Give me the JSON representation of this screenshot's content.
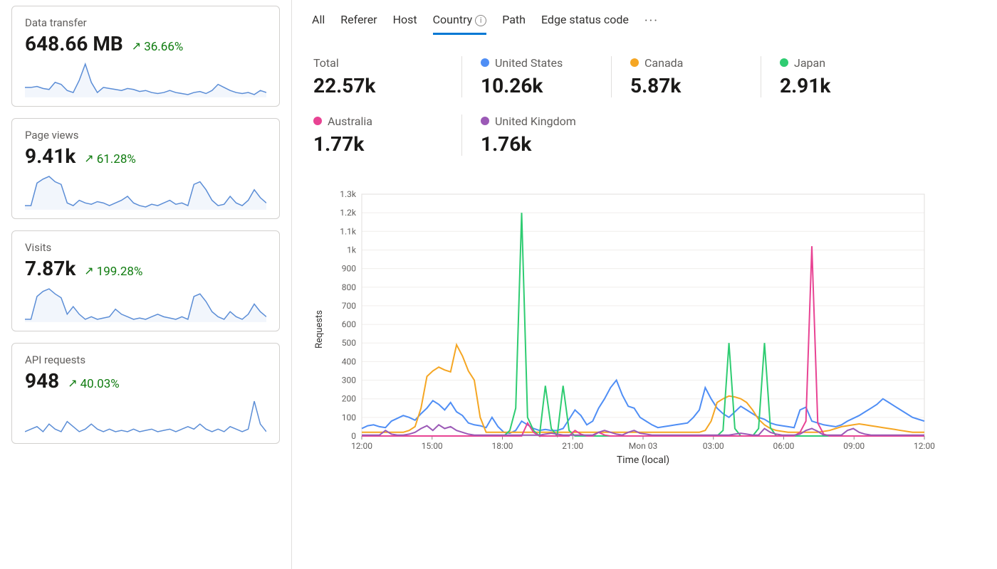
{
  "sidebar": {
    "cards": [
      {
        "label": "Data transfer",
        "value": "648.66 MB",
        "delta": "36.66%"
      },
      {
        "label": "Page views",
        "value": "9.41k",
        "delta": "61.28%"
      },
      {
        "label": "Visits",
        "value": "7.87k",
        "delta": "199.28%"
      },
      {
        "label": "API requests",
        "value": "948",
        "delta": "40.03%"
      }
    ]
  },
  "tabs": {
    "items": [
      "All",
      "Referer",
      "Host",
      "Country",
      "Path",
      "Edge status code"
    ],
    "active": "Country",
    "more_icon": "more-icon"
  },
  "stats": [
    {
      "label": "Total",
      "value": "22.57k",
      "color": null,
      "rowstart": true
    },
    {
      "label": "United States",
      "value": "10.26k",
      "color": "#4f8ef5"
    },
    {
      "label": "Canada",
      "value": "5.87k",
      "color": "#f5a623"
    },
    {
      "label": "Japan",
      "value": "2.91k",
      "color": "#2ecc71"
    },
    {
      "label": "Australia",
      "value": "1.77k",
      "color": "#e84393",
      "rowstart": true
    },
    {
      "label": "United Kingdom",
      "value": "1.76k",
      "color": "#9b59b6"
    }
  ],
  "chart_data": {
    "type": "line",
    "xlabel": "Time (local)",
    "ylabel": "Requests",
    "ylim": [
      0,
      1300
    ],
    "x_ticks": [
      "12:00",
      "15:00",
      "18:00",
      "21:00",
      "Mon 03",
      "03:00",
      "06:00",
      "09:00",
      "12:00"
    ],
    "y_ticks": [
      0,
      100,
      200,
      300,
      400,
      500,
      600,
      700,
      800,
      900,
      1000,
      1100,
      1200,
      1300
    ],
    "y_tick_labels": [
      "0",
      "100",
      "200",
      "300",
      "400",
      "500",
      "600",
      "700",
      "800",
      "900",
      "1k",
      "1.1k",
      "1.2k",
      "1.3k"
    ],
    "point_count": 96,
    "series": [
      {
        "name": "United States",
        "color": "#4f8ef5",
        "values": [
          40,
          55,
          60,
          50,
          45,
          80,
          95,
          110,
          100,
          85,
          120,
          150,
          190,
          170,
          140,
          180,
          130,
          110,
          70,
          60,
          55,
          45,
          100,
          50,
          20,
          15,
          30,
          80,
          60,
          40,
          30,
          35,
          30,
          30,
          40,
          90,
          140,
          110,
          60,
          80,
          150,
          200,
          260,
          300,
          220,
          160,
          150,
          100,
          80,
          60,
          45,
          50,
          55,
          60,
          65,
          70,
          100,
          140,
          260,
          200,
          150,
          120,
          100,
          130,
          160,
          140,
          120,
          100,
          90,
          70,
          60,
          55,
          50,
          45,
          140,
          155,
          80,
          70,
          60,
          55,
          50,
          60,
          80,
          95,
          110,
          130,
          150,
          170,
          200,
          180,
          160,
          140,
          120,
          100,
          90,
          80
        ]
      },
      {
        "name": "Canada",
        "color": "#f5a623",
        "values": [
          20,
          20,
          20,
          20,
          20,
          20,
          20,
          20,
          30,
          50,
          150,
          320,
          350,
          370,
          355,
          345,
          490,
          430,
          350,
          300,
          100,
          20,
          20,
          20,
          20,
          20,
          20,
          20,
          20,
          20,
          20,
          20,
          20,
          20,
          20,
          20,
          20,
          20,
          20,
          20,
          20,
          20,
          20,
          20,
          20,
          20,
          20,
          20,
          20,
          20,
          20,
          20,
          20,
          20,
          20,
          20,
          20,
          20,
          30,
          80,
          180,
          200,
          215,
          210,
          200,
          180,
          140,
          90,
          60,
          40,
          30,
          25,
          20,
          20,
          20,
          20,
          20,
          20,
          25,
          30,
          40,
          50,
          55,
          60,
          65,
          60,
          55,
          50,
          45,
          40,
          35,
          30,
          25,
          20,
          20,
          20
        ]
      },
      {
        "name": "Japan",
        "color": "#2ecc71",
        "values": [
          0,
          0,
          0,
          0,
          0,
          0,
          0,
          0,
          0,
          0,
          0,
          0,
          0,
          0,
          0,
          0,
          0,
          0,
          0,
          0,
          0,
          0,
          0,
          0,
          0,
          30,
          150,
          1200,
          100,
          30,
          0,
          270,
          40,
          0,
          270,
          30,
          0,
          0,
          0,
          0,
          0,
          0,
          0,
          0,
          0,
          0,
          0,
          0,
          0,
          0,
          0,
          0,
          0,
          0,
          0,
          0,
          0,
          0,
          0,
          0,
          0,
          30,
          500,
          40,
          0,
          0,
          0,
          40,
          500,
          45,
          0,
          0,
          0,
          0,
          0,
          0,
          0,
          0,
          0,
          0,
          0,
          0,
          0,
          0,
          0,
          0,
          0,
          0,
          0,
          0,
          0,
          0,
          0,
          0,
          0,
          0
        ]
      },
      {
        "name": "Australia",
        "color": "#e84393",
        "values": [
          0,
          0,
          0,
          0,
          0,
          0,
          0,
          0,
          0,
          0,
          0,
          0,
          0,
          0,
          0,
          0,
          0,
          0,
          0,
          0,
          0,
          0,
          0,
          0,
          0,
          0,
          0,
          0,
          70,
          20,
          0,
          0,
          0,
          0,
          0,
          0,
          30,
          10,
          0,
          0,
          20,
          5,
          0,
          0,
          0,
          0,
          0,
          0,
          0,
          0,
          0,
          0,
          0,
          0,
          0,
          0,
          0,
          0,
          0,
          0,
          0,
          0,
          0,
          0,
          0,
          0,
          0,
          0,
          0,
          0,
          0,
          0,
          0,
          0,
          20,
          80,
          1020,
          70,
          10,
          0,
          0,
          0,
          0,
          0,
          0,
          0,
          0,
          0,
          0,
          0,
          0,
          0,
          0,
          0,
          0,
          0
        ]
      },
      {
        "name": "United Kingdom",
        "color": "#9b59b6",
        "values": [
          5,
          5,
          5,
          5,
          30,
          10,
          5,
          5,
          10,
          20,
          40,
          55,
          30,
          60,
          40,
          50,
          30,
          20,
          10,
          5,
          5,
          5,
          5,
          5,
          5,
          5,
          5,
          5,
          5,
          5,
          5,
          10,
          15,
          10,
          5,
          5,
          5,
          5,
          5,
          5,
          20,
          30,
          20,
          10,
          5,
          20,
          30,
          15,
          10,
          5,
          5,
          5,
          5,
          5,
          5,
          5,
          5,
          5,
          5,
          5,
          5,
          5,
          5,
          10,
          15,
          10,
          5,
          5,
          40,
          20,
          10,
          5,
          5,
          5,
          10,
          30,
          40,
          25,
          5,
          5,
          5,
          5,
          30,
          40,
          20,
          10,
          5,
          5,
          5,
          5,
          5,
          5,
          5,
          5,
          5,
          5
        ]
      }
    ]
  },
  "spark_areas": [
    0,
    1,
    2
  ],
  "sparklines": [
    [
      25,
      25,
      26,
      24,
      23,
      30,
      28,
      22,
      20,
      32,
      48,
      30,
      20,
      25,
      24,
      23,
      22,
      24,
      23,
      21,
      22,
      20,
      19,
      20,
      22,
      20,
      19,
      18,
      20,
      21,
      19,
      22,
      28,
      25,
      22,
      20,
      19,
      20,
      18,
      22,
      20
    ],
    [
      18,
      18,
      35,
      38,
      40,
      36,
      34,
      20,
      18,
      22,
      20,
      19,
      21,
      20,
      18,
      20,
      22,
      25,
      20,
      18,
      17,
      19,
      18,
      20,
      22,
      19,
      20,
      18,
      34,
      36,
      30,
      22,
      18,
      19,
      25,
      20,
      18,
      22,
      30,
      24,
      20
    ],
    [
      18,
      18,
      36,
      40,
      42,
      38,
      35,
      22,
      28,
      22,
      18,
      20,
      18,
      19,
      20,
      26,
      22,
      20,
      18,
      19,
      18,
      20,
      22,
      20,
      19,
      18,
      20,
      18,
      36,
      38,
      32,
      24,
      20,
      18,
      24,
      20,
      18,
      22,
      30,
      24,
      20
    ],
    [
      18,
      20,
      22,
      18,
      24,
      20,
      18,
      26,
      22,
      18,
      20,
      24,
      20,
      18,
      20,
      18,
      19,
      18,
      20,
      18,
      19,
      20,
      18,
      19,
      20,
      18,
      20,
      22,
      20,
      24,
      20,
      18,
      20,
      18,
      22,
      20,
      18,
      20,
      42,
      24,
      18
    ]
  ]
}
